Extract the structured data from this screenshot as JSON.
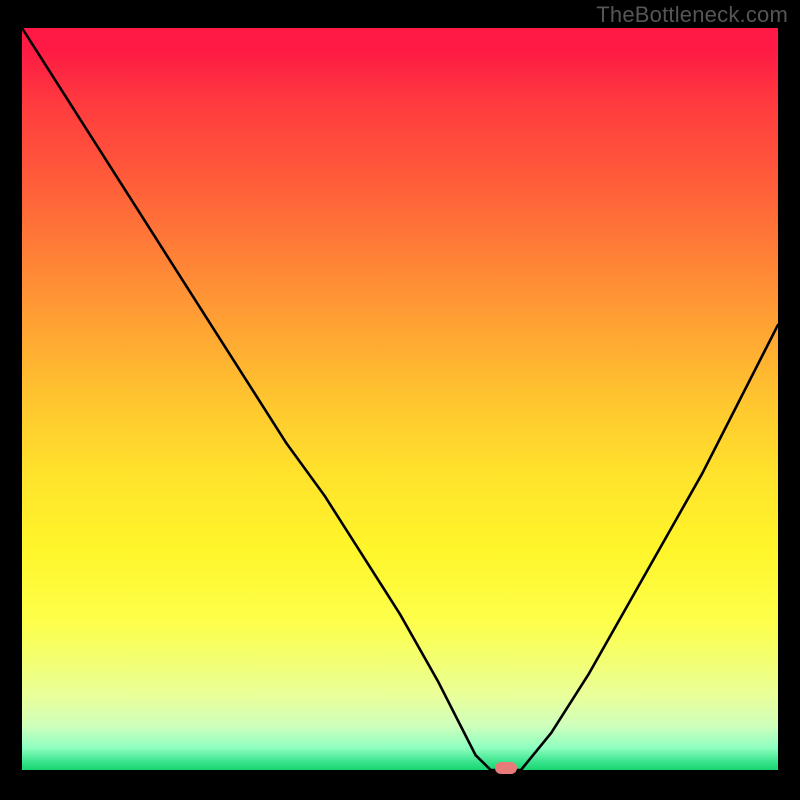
{
  "watermark": "TheBottleneck.com",
  "colors": {
    "page_bg": "#000000",
    "curve": "#000000",
    "marker": "#e77b7a",
    "gradient_top": "#fe1a44",
    "gradient_bottom": "#18d672"
  },
  "chart_data": {
    "type": "line",
    "title": "",
    "xlabel": "",
    "ylabel": "",
    "xlim": [
      0,
      100
    ],
    "ylim": [
      0,
      100
    ],
    "grid": false,
    "legend": false,
    "series": [
      {
        "name": "bottleneck-curve",
        "x": [
          0,
          5,
          10,
          15,
          20,
          25,
          30,
          35,
          40,
          45,
          50,
          55,
          58,
          60,
          62,
          64,
          66,
          70,
          75,
          80,
          85,
          90,
          95,
          100
        ],
        "y": [
          100,
          92,
          84,
          76,
          68,
          60,
          52,
          44,
          37,
          29,
          21,
          12,
          6,
          2,
          0,
          0,
          0,
          5,
          13,
          22,
          31,
          40,
          50,
          60
        ]
      }
    ],
    "marker": {
      "x": 64,
      "y": 0
    },
    "background_gradient": {
      "direction": "top-to-bottom",
      "stops": [
        {
          "pos": 0.0,
          "color": "#fe1a44"
        },
        {
          "pos": 0.5,
          "color": "#ffc52f"
        },
        {
          "pos": 0.8,
          "color": "#fdff4a"
        },
        {
          "pos": 0.97,
          "color": "#8effc0"
        },
        {
          "pos": 1.0,
          "color": "#18d672"
        }
      ]
    }
  }
}
